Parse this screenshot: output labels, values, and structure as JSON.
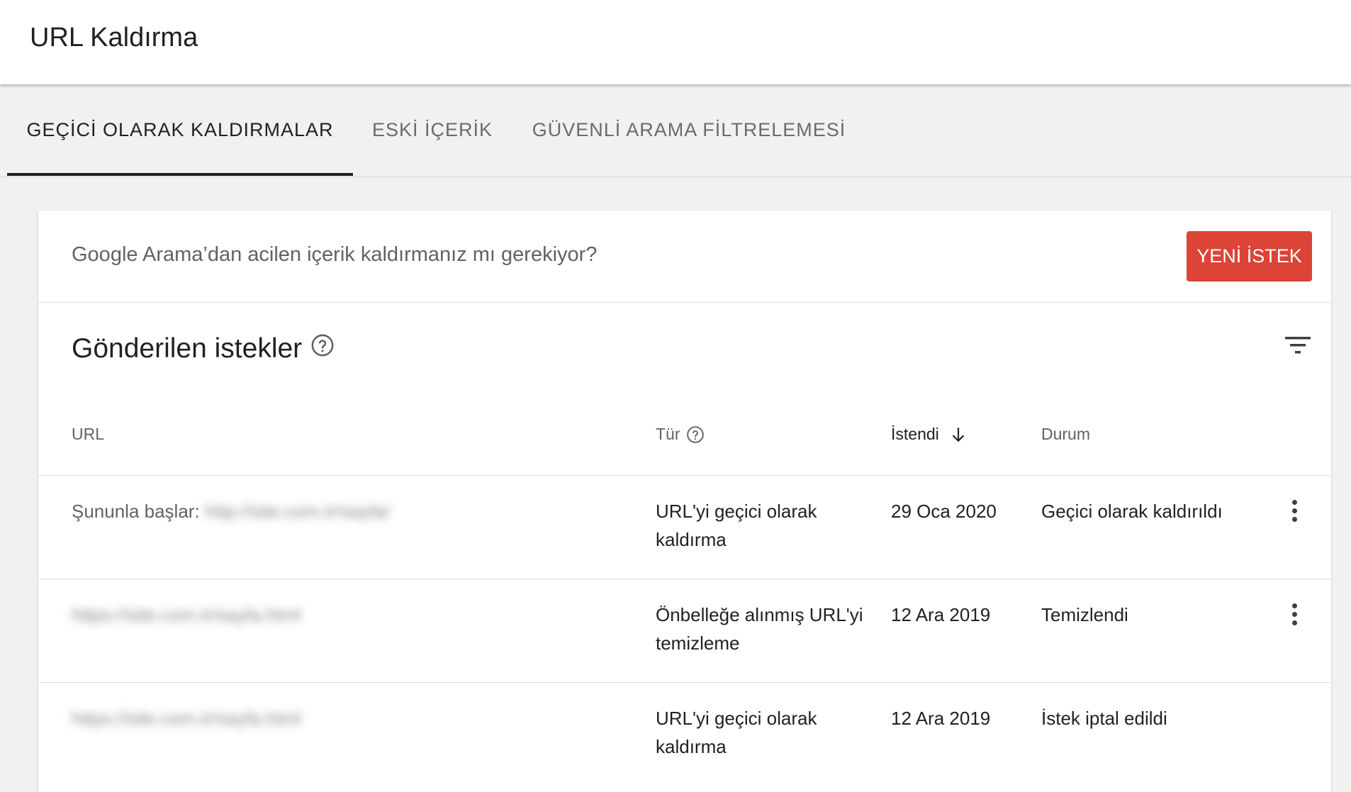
{
  "header": {
    "title": "URL Kaldırma"
  },
  "tabs": [
    {
      "label": "GEÇİCİ OLARAK KALDIRMALAR",
      "active": true
    },
    {
      "label": "ESKİ İÇERİK",
      "active": false
    },
    {
      "label": "GÜVENLİ ARAMA FİLTRELEMESİ",
      "active": false
    }
  ],
  "banner": {
    "text": "Google Arama’dan acilen içerik kaldırmanız mı gerekiyor?",
    "button_label": "YENİ İSTEK",
    "button_color": "#db4437"
  },
  "requests": {
    "title": "Gönderilen istekler",
    "help_icon": "help-circle-icon",
    "filter_icon": "filter-icon",
    "columns": {
      "url": "URL",
      "type": "Tür",
      "requested": "İstendi",
      "status": "Durum"
    },
    "sort_icon": "arrow-down-icon",
    "rows": [
      {
        "url_prefix": "Şununla başlar:",
        "url_value": "http://site.com.tr/sayfa/",
        "type_line1": "URL'yi geçici olarak",
        "type_line2": "kaldırma",
        "requested": "29 Oca 2020",
        "status": "Geçici olarak kaldırıldı",
        "has_menu": true
      },
      {
        "url_prefix": "",
        "url_value": "https://site.com.tr/sayfa.html",
        "type_line1": "Önbelleğe alınmış URL'yi",
        "type_line2": "temizleme",
        "requested": "12 Ara 2019",
        "status": "Temizlendi",
        "has_menu": true
      },
      {
        "url_prefix": "",
        "url_value": "https://site.com.tr/sayfa.html",
        "type_line1": "URL'yi geçici olarak",
        "type_line2": "kaldırma",
        "requested": "12 Ara 2019",
        "status": "İstek iptal edildi",
        "has_menu": false
      }
    ]
  }
}
